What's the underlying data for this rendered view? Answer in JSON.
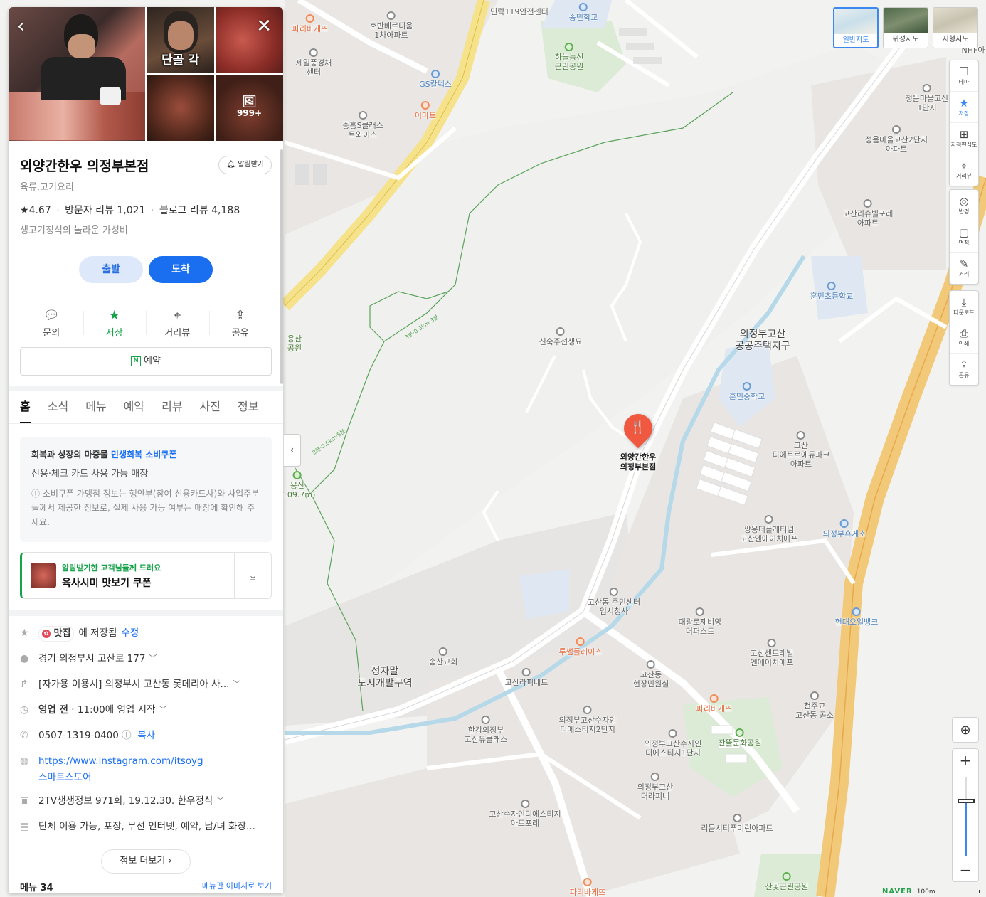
{
  "panel": {
    "photo_count": "999+",
    "photo_caption": "단골 각",
    "place_name": "외양간한우 의정부본점",
    "alert_label": "알림받기",
    "category": "육류,고기요리",
    "rating": "4.67",
    "visitor_reviews": "방문자 리뷰 1,021",
    "blog_reviews": "블로그 리뷰 4,188",
    "description": "생고기정식의 놀라운 가성비",
    "depart_label": "출발",
    "arrive_label": "도착",
    "actions": [
      {
        "label": "문의",
        "icon": "chat-icon"
      },
      {
        "label": "저장",
        "icon": "star-icon"
      },
      {
        "label": "거리뷰",
        "icon": "pin-icon"
      },
      {
        "label": "공유",
        "icon": "share-icon"
      }
    ],
    "reserve_label": "예약",
    "tabs": [
      "홈",
      "소식",
      "메뉴",
      "예약",
      "리뷰",
      "사진",
      "정보"
    ],
    "coupon": {
      "head_prefix": "회복과 성장의 마중물 ",
      "head_highlight": "민생회복 소비쿠폰",
      "sub": "신용·체크 카드 사용 가능 매장",
      "note": "ⓘ 소비쿠폰 가맹점 정보는 행안부(참여 신용카드사)와 사업주분들께서 제공한 정보로, 실제 사용 가능 여부는 매장에 확인해 주세요."
    },
    "promo": {
      "line1": "알림받기한 고객님들께 드려요",
      "line2": "육사시미 맛보기 쿠폰"
    },
    "saved": {
      "badge": "맛집",
      "text": "에 저장됨",
      "edit": "수정"
    },
    "address": "경기 의정부시 고산로 177",
    "directions": "[자가용 이용시] 의정부시 고산동 롯데리아 사...",
    "hours_status": "영업 전",
    "hours_detail": "· 11:00에 영업 시작",
    "phone": "0507-1319-0400",
    "phone_copy": "복사",
    "website": "https://www.instagram.com/itsoyg",
    "store": "스마트스토어",
    "tv": "2TV생생정보 971회, 19.12.30. 한우정식",
    "facilities": "단체 이용 가능, 포장, 무선 인터넷, 예약, 남/녀 화장...",
    "more_info": "정보 더보기",
    "bottom_left": "메뉴 34",
    "bottom_right": "메뉴판 이미지로 보기"
  },
  "map": {
    "types": [
      {
        "label": "일반지도",
        "active": true
      },
      {
        "label": "위성지도",
        "active": false
      },
      {
        "label": "지형지도",
        "active": false
      }
    ],
    "tools_group1": [
      {
        "label": "테마",
        "icon": "layers-icon"
      },
      {
        "label": "저장",
        "icon": "star-icon",
        "on": true
      },
      {
        "label": "지적편집도",
        "icon": "grid-icon"
      },
      {
        "label": "거리뷰",
        "icon": "pin-icon"
      }
    ],
    "tools_group2": [
      {
        "label": "반경",
        "icon": "radius-icon"
      },
      {
        "label": "면적",
        "icon": "area-icon"
      },
      {
        "label": "거리",
        "icon": "ruler-icon"
      }
    ],
    "tools_group3": [
      {
        "label": "다운로드",
        "icon": "download-icon"
      },
      {
        "label": "인쇄",
        "icon": "print-icon"
      },
      {
        "label": "공유",
        "icon": "share-icon"
      }
    ],
    "zoom_level": 0.7,
    "scale_label": "100m",
    "brand": "NAVER",
    "target_label_1": "외양간한우",
    "target_label_2": "의정부본점",
    "pois": [
      {
        "text": "파리바게뜨",
        "style": "orange"
      },
      {
        "text": "호반베르디움\n1차아파트",
        "style": ""
      },
      {
        "text": "민락119안전센터",
        "style": ""
      },
      {
        "text": "송민학교",
        "style": "blue"
      },
      {
        "text": "하늘능선\n근린공원",
        "style": "green"
      },
      {
        "text": "제일풍경채\n센터",
        "style": ""
      },
      {
        "text": "GS칼텍스",
        "style": "blue"
      },
      {
        "text": "이마트",
        "style": "orange"
      },
      {
        "text": "중흥S클래스\n트와이스",
        "style": ""
      },
      {
        "text": "정음마을고산\n1단지",
        "style": ""
      },
      {
        "text": "정음마을고산2단지\n아파트",
        "style": ""
      },
      {
        "text": "고산리슈빌포레\n아파트",
        "style": ""
      },
      {
        "text": "훈민초등학교",
        "style": "blue"
      },
      {
        "text": "신숙주선생묘",
        "style": ""
      },
      {
        "text": "의정부고산\n공공주택지구",
        "style": "big"
      },
      {
        "text": "훈민중학교",
        "style": "blue"
      },
      {
        "text": "고산\n디에트르에듀파크\n아파트",
        "style": ""
      },
      {
        "text": "쌍용더플래티넘\n고산엔에이치에프",
        "style": ""
      },
      {
        "text": "의정부휴게소",
        "style": "blue"
      },
      {
        "text": "고산동 주민센터\n임시청사",
        "style": ""
      },
      {
        "text": "대광로제비앙\n더퍼스트",
        "style": ""
      },
      {
        "text": "현대오일뱅크",
        "style": "blue"
      },
      {
        "text": "투썸플레이스",
        "style": "orange"
      },
      {
        "text": "송산교회",
        "style": ""
      },
      {
        "text": "정자말\n도시개발구역",
        "style": "big"
      },
      {
        "text": "고산라피네트",
        "style": ""
      },
      {
        "text": "고산동\n현장민원실",
        "style": ""
      },
      {
        "text": "고산센트레빌\n엔에이치에프",
        "style": ""
      },
      {
        "text": "파리바게뜨",
        "style": "orange"
      },
      {
        "text": "천주교\n고산동 공소",
        "style": ""
      },
      {
        "text": "한강의정부\n고산듀클래스",
        "style": ""
      },
      {
        "text": "의정부고산수자인\n디에스티지2단지",
        "style": ""
      },
      {
        "text": "의정부고산수자인\n디에스티지1단지",
        "style": ""
      },
      {
        "text": "잔뜰문화공원",
        "style": "green"
      },
      {
        "text": "의정부고산\n더라피네",
        "style": ""
      },
      {
        "text": "고산수자인디에스티지\n아트포레",
        "style": ""
      },
      {
        "text": "리듬시티푸미린아파트",
        "style": ""
      },
      {
        "text": "파리바게뜨",
        "style": "orange"
      },
      {
        "text": "산꽃근린공원",
        "style": "green"
      },
      {
        "text": "용산\n공원",
        "style": "green"
      },
      {
        "text": "용산\n(109.7m)",
        "style": "green"
      },
      {
        "text": "NHF아",
        "style": ""
      }
    ],
    "trail_labels": [
      "3분·0.3km·3분",
      "8분·0.6km·5분"
    ]
  }
}
